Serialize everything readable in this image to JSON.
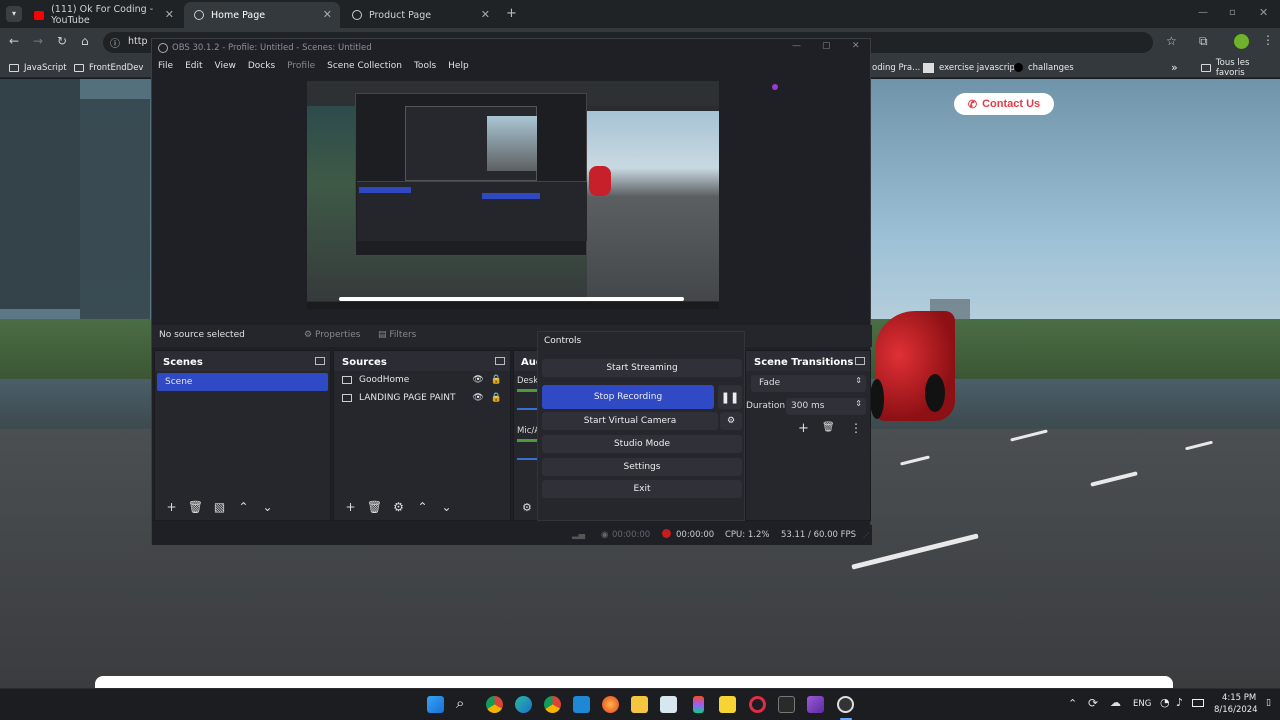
{
  "browser": {
    "tabs": [
      {
        "label": "(111) Ok For Coding - YouTube",
        "close": "✕"
      },
      {
        "label": "Home Page",
        "close": "✕"
      },
      {
        "label": "Product Page",
        "close": "✕"
      }
    ],
    "new_tab": "+",
    "address": "http",
    "bookmarks": [
      "JavaScript",
      "FrontEndDev",
      "oding Pra...",
      "exercise javascript",
      "challanges"
    ],
    "bookmarks_overflow": "»",
    "all_bookmarks": "Tous les favoris"
  },
  "page": {
    "contact_button": "Contact Us"
  },
  "obs": {
    "title": "OBS 30.1.2 - Profile: Untitled - Scenes: Untitled",
    "menu": [
      "File",
      "Edit",
      "View",
      "Docks",
      "Profile",
      "Scene Collection",
      "Tools",
      "Help"
    ],
    "no_source": "No source selected",
    "properties": "Properties",
    "filters": "Filters",
    "scenes": {
      "title": "Scenes",
      "items": [
        "Scene"
      ]
    },
    "sources": {
      "title": "Sources",
      "items": [
        "GoodHome",
        "LANDING PAGE PAINT"
      ]
    },
    "audio": {
      "title": "Aud",
      "items": [
        "Deskt",
        "Mic/A"
      ]
    },
    "transitions": {
      "title": "Scene Transitions",
      "type": "Fade",
      "duration_label": "Duration",
      "duration_value": "300 ms"
    },
    "controls": {
      "title": "Controls",
      "start_streaming": "Start Streaming",
      "stop_recording": "Stop Recording",
      "start_virtual_camera": "Start Virtual Camera",
      "studio_mode": "Studio Mode",
      "settings": "Settings",
      "exit": "Exit"
    },
    "status": {
      "stream_time": "00:00:00",
      "rec_time": "00:00:00",
      "cpu": "CPU: 1.2%",
      "fps": "53.11 / 60.00 FPS"
    }
  },
  "taskbar": {
    "lang": "ENG",
    "time": "4:15 PM",
    "date": "8/16/2024"
  },
  "colors": {
    "accent": "#3049c5",
    "contact_red": "#e63946"
  }
}
